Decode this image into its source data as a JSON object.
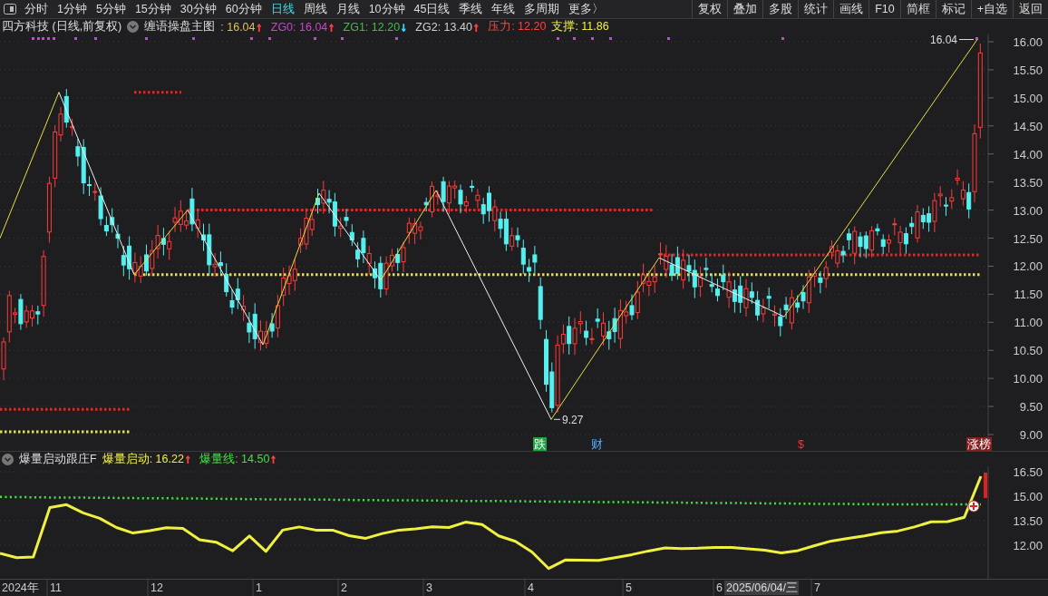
{
  "toolbar": {
    "tabs": [
      {
        "label": "分时",
        "selected": false
      },
      {
        "label": "1分钟",
        "selected": false
      },
      {
        "label": "5分钟",
        "selected": false
      },
      {
        "label": "15分钟",
        "selected": false
      },
      {
        "label": "30分钟",
        "selected": false
      },
      {
        "label": "60分钟",
        "selected": false
      },
      {
        "label": "日线",
        "selected": true
      },
      {
        "label": "周线",
        "selected": false
      },
      {
        "label": "月线",
        "selected": false
      },
      {
        "label": "10分钟",
        "selected": false
      },
      {
        "label": "45日线",
        "selected": false
      },
      {
        "label": "季线",
        "selected": false
      },
      {
        "label": "年线",
        "selected": false
      },
      {
        "label": "多周期",
        "selected": false
      },
      {
        "label": "更多〉",
        "selected": false
      }
    ],
    "buttons": [
      "复权",
      "叠加",
      "多股",
      "统计",
      "画线",
      "F10",
      "简框",
      "标记",
      "+自选",
      "返回"
    ]
  },
  "header": {
    "title": "四方科技 (日线,前复权)",
    "indicator": "缠语操盘主图",
    "legend": [
      {
        "text": ": 16.04",
        "arrow": {
          "text": "↑",
          "color": "#ff4040"
        },
        "color": "#e0c050"
      },
      {
        "text": "ZG0: 16.04",
        "arrow": {
          "text": "↑",
          "color": "#ff4040"
        },
        "color": "#d040d0"
      },
      {
        "text": "ZG1: 12.20",
        "arrow": {
          "text": "↓",
          "color": "#40d0ff"
        },
        "color": "#40c040"
      },
      {
        "text": "ZG2: 13.40",
        "arrow": {
          "text": "↑",
          "color": "#ff4040"
        },
        "color": "#d0d0d0"
      },
      {
        "text": "压力: 12.20",
        "color": "#ff4040"
      },
      {
        "text": "支撑: 11.86",
        "color": "#f0f040"
      }
    ]
  },
  "price_chart": {
    "yticks": [
      "16.00",
      "15.50",
      "15.00",
      "14.50",
      "14.00",
      "13.50",
      "13.00",
      "12.50",
      "12.00",
      "11.50",
      "11.00",
      "10.50",
      "10.00",
      "9.50",
      "9.00"
    ],
    "peak_label": "16.04",
    "trough_label": "9.27",
    "markers": [
      {
        "text": "跌",
        "kind": "boxed",
        "color": "#20a040"
      },
      {
        "text": "财",
        "kind": "plain",
        "color": "#60b0ff"
      },
      {
        "text": "$",
        "kind": "plain",
        "color": "#ff3030"
      },
      {
        "text": "涨榜",
        "kind": "boxed",
        "color": "#802020"
      }
    ]
  },
  "indicator_panel": {
    "name": "爆量启动跟庄F",
    "legend": [
      {
        "value": ": 16.22",
        "arrow": {
          "text": "↑",
          "color": "#ff4040"
        }
      },
      {
        "value": ": 14.50",
        "arrow": {
          "text": "↑",
          "color": "#ff4040"
        }
      }
    ],
    "chart_data": {
      "type": "line",
      "ylim": [
        9.94,
        16.83
      ],
      "grid": true,
      "yticks": [
        {
          "value": 16.5,
          "label": "16.50"
        },
        {
          "value": 15,
          "label": "15.00"
        },
        {
          "value": 13.5,
          "label": "13.50"
        },
        {
          "value": 12,
          "label": "12.00"
        }
      ],
      "series": [
        {
          "name": "爆量启动",
          "color": "#f0f040",
          "line_style": "solid",
          "values": [
            11.5,
            11.23,
            11.28,
            14.31,
            14.48,
            13.98,
            13.64,
            13.08,
            12.74,
            12.89,
            13.06,
            13.02,
            12.33,
            12.18,
            11.65,
            12.56,
            11.62,
            12.92,
            13.11,
            12.92,
            12.92,
            12.58,
            12.42,
            12.71,
            12.92,
            13.0,
            13.12,
            13.08,
            13.41,
            13.26,
            12.56,
            12.23,
            11.58,
            10.57,
            11.09,
            11.08,
            11.06,
            11.23,
            11.42,
            11.64,
            11.83,
            11.79,
            11.81,
            11.86,
            11.86,
            11.78,
            11.69,
            11.53,
            11.67,
            11.97,
            12.25,
            12.41,
            12.57,
            12.76,
            12.86,
            13.11,
            13.43,
            13.44,
            13.71,
            16.22
          ]
        },
        {
          "name": "爆量线",
          "color": "#40e040",
          "line_style": "dotted",
          "values": [
            14.95,
            14.94,
            14.93,
            14.92,
            14.92,
            14.91,
            14.9,
            14.89,
            14.88,
            14.87,
            14.87,
            14.86,
            14.85,
            14.84,
            14.83,
            14.82,
            14.81,
            14.81,
            14.8,
            14.79,
            14.78,
            14.77,
            14.76,
            14.75,
            14.75,
            14.74,
            14.73,
            14.72,
            14.71,
            14.7,
            14.7,
            14.69,
            14.68,
            14.67,
            14.66,
            14.65,
            14.64,
            14.64,
            14.63,
            14.62,
            14.61,
            14.6,
            14.59,
            14.58,
            14.58,
            14.57,
            14.56,
            14.55,
            14.54,
            14.53,
            14.53,
            14.52,
            14.51,
            14.5,
            14.5,
            14.5,
            14.5,
            14.5,
            14.5,
            14.5
          ]
        }
      ]
    }
  },
  "time_axis": {
    "labels": [
      "2024年",
      "11",
      "12",
      "1",
      "2",
      "3",
      "4",
      "5",
      "6",
      "7"
    ],
    "cursor_label": "2025/06/04/三"
  }
}
